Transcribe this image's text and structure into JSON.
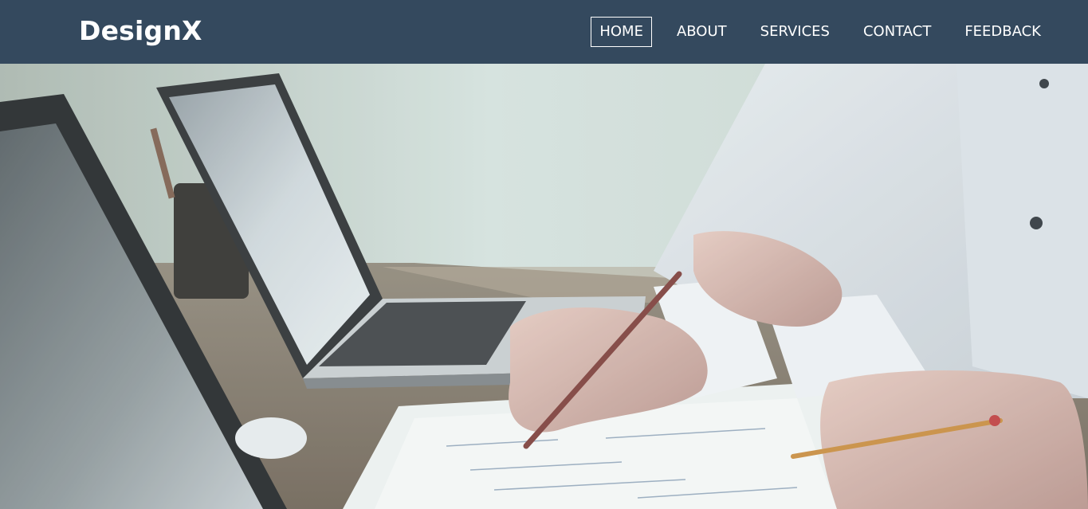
{
  "brand": {
    "name": "DesignX"
  },
  "nav": {
    "items": [
      {
        "label": "HOME",
        "active": true
      },
      {
        "label": "ABOUT",
        "active": false
      },
      {
        "label": "SERVICES",
        "active": false
      },
      {
        "label": "CONTACT",
        "active": false
      },
      {
        "label": "FEEDBACK",
        "active": false
      }
    ]
  },
  "colors": {
    "navbar_bg": "#34495e",
    "nav_text": "#ffffff"
  }
}
